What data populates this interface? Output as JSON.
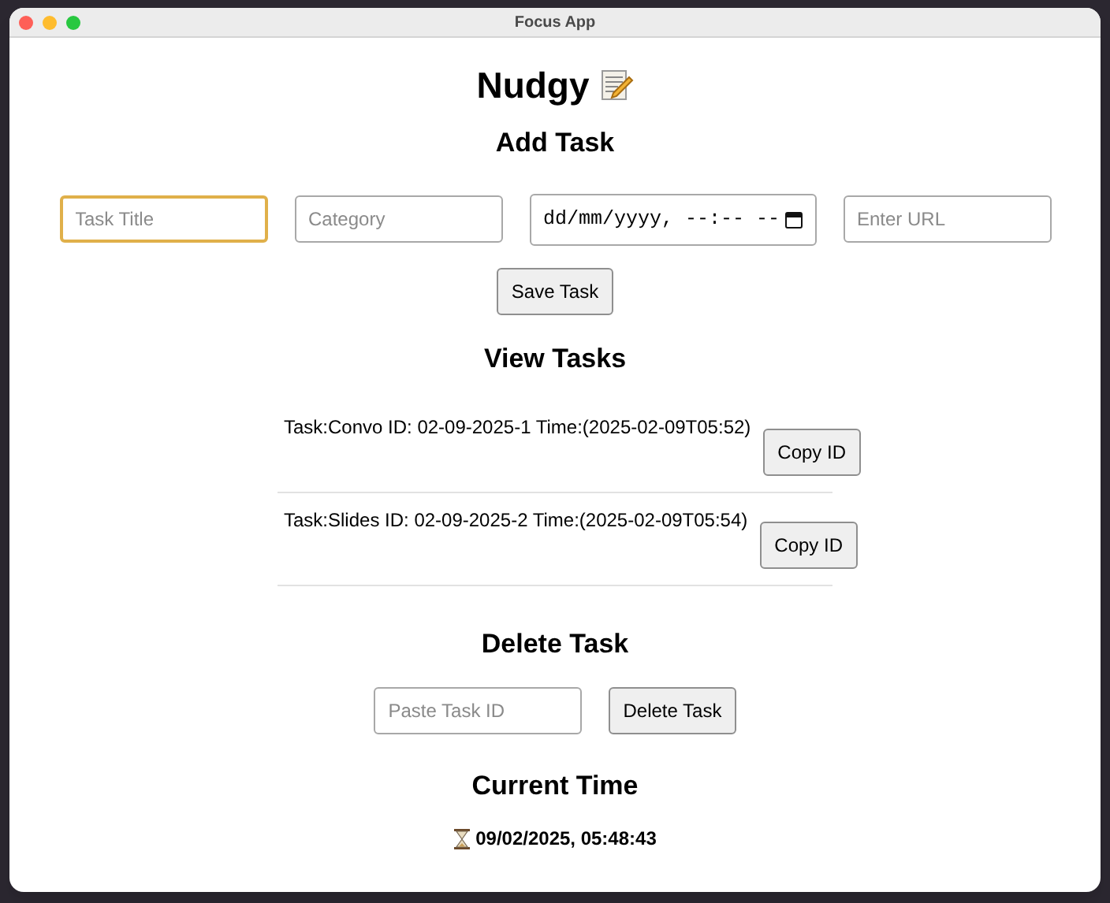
{
  "window": {
    "title": "Focus App"
  },
  "app_title": "Nudgy",
  "add_task": {
    "heading": "Add Task",
    "fields": [
      {
        "kind": "text",
        "placeholder": "Task Title",
        "focused": true
      },
      {
        "kind": "text",
        "placeholder": "Category",
        "focused": false
      },
      {
        "kind": "datetime",
        "placeholder": "dd/mm/yyyy, --:-- --",
        "focused": false
      },
      {
        "kind": "text",
        "placeholder": "Enter URL",
        "focused": false
      }
    ],
    "button": "Save Task"
  },
  "view_tasks": {
    "heading": "View Tasks",
    "tasks": [
      {
        "text": "Task:Convo ID: 02-09-2025-1 Time:(2025-02-09T05:52)",
        "button": "Copy ID"
      },
      {
        "text": "Task:Slides ID: 02-09-2025-2 Time:(2025-02-09T05:54)",
        "button": "Copy ID"
      }
    ]
  },
  "delete_task": {
    "heading": "Delete Task",
    "placeholder": "Paste Task ID",
    "button": "Delete Task"
  },
  "current_time": {
    "heading": "Current Time",
    "value": "09/02/2025, 05:48:43"
  }
}
